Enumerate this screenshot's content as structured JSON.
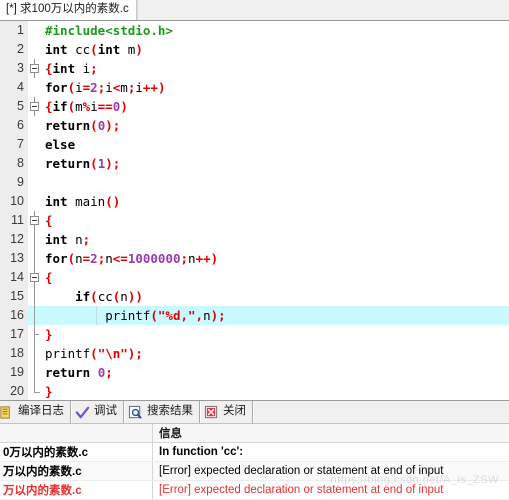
{
  "editor": {
    "tab_title": "[*] 求100万以内的素数.c",
    "current_line": 16,
    "highlight_color": "#c9faff",
    "gutter_color": "#ededed",
    "lines": [
      {
        "n": "1",
        "fold": "none",
        "tokens": [
          {
            "t": "#include<stdio.h>",
            "c": "pp"
          }
        ]
      },
      {
        "n": "2",
        "fold": "none",
        "tokens": [
          {
            "t": "int",
            "c": "k"
          },
          {
            "t": " cc",
            "c": "id"
          },
          {
            "t": "(",
            "c": "op"
          },
          {
            "t": "int",
            "c": "k"
          },
          {
            "t": " m",
            "c": "id"
          },
          {
            "t": ")",
            "c": "op"
          }
        ]
      },
      {
        "n": "3",
        "fold": "box",
        "tokens": [
          {
            "t": "{",
            "c": "op"
          },
          {
            "t": "int",
            "c": "k"
          },
          {
            "t": " i",
            "c": "id"
          },
          {
            "t": ";",
            "c": "op"
          }
        ]
      },
      {
        "n": "4",
        "fold": "none",
        "tokens": [
          {
            "t": "for",
            "c": "k"
          },
          {
            "t": "(",
            "c": "op"
          },
          {
            "t": "i",
            "c": "id"
          },
          {
            "t": "=",
            "c": "op"
          },
          {
            "t": "2",
            "c": "num"
          },
          {
            "t": ";",
            "c": "op"
          },
          {
            "t": "i",
            "c": "id"
          },
          {
            "t": "<",
            "c": "op"
          },
          {
            "t": "m",
            "c": "id"
          },
          {
            "t": ";",
            "c": "op"
          },
          {
            "t": "i",
            "c": "id"
          },
          {
            "t": "++",
            "c": "op"
          },
          {
            "t": ")",
            "c": "op"
          }
        ]
      },
      {
        "n": "5",
        "fold": "box",
        "tokens": [
          {
            "t": "{",
            "c": "op"
          },
          {
            "t": "if",
            "c": "k"
          },
          {
            "t": "(",
            "c": "op"
          },
          {
            "t": "m",
            "c": "id"
          },
          {
            "t": "%",
            "c": "op"
          },
          {
            "t": "i",
            "c": "id"
          },
          {
            "t": "==",
            "c": "op"
          },
          {
            "t": "0",
            "c": "num"
          },
          {
            "t": ")",
            "c": "op"
          }
        ]
      },
      {
        "n": "6",
        "fold": "none",
        "tokens": [
          {
            "t": "return",
            "c": "k"
          },
          {
            "t": "(",
            "c": "op"
          },
          {
            "t": "0",
            "c": "num"
          },
          {
            "t": ")",
            "c": "op"
          },
          {
            "t": ";",
            "c": "op"
          }
        ]
      },
      {
        "n": "7",
        "fold": "none",
        "tokens": [
          {
            "t": "else",
            "c": "k"
          }
        ]
      },
      {
        "n": "8",
        "fold": "none",
        "tokens": [
          {
            "t": "return",
            "c": "k"
          },
          {
            "t": "(",
            "c": "op"
          },
          {
            "t": "1",
            "c": "num"
          },
          {
            "t": ")",
            "c": "op"
          },
          {
            "t": ";",
            "c": "op"
          }
        ]
      },
      {
        "n": "9",
        "fold": "none",
        "tokens": []
      },
      {
        "n": "10",
        "fold": "none",
        "tokens": [
          {
            "t": "int",
            "c": "k"
          },
          {
            "t": " main",
            "c": "id"
          },
          {
            "t": "()",
            "c": "op"
          }
        ]
      },
      {
        "n": "11",
        "fold": "box-open",
        "tokens": [
          {
            "t": "{",
            "c": "op"
          }
        ]
      },
      {
        "n": "12",
        "fold": "line",
        "tokens": [
          {
            "t": "int",
            "c": "k"
          },
          {
            "t": " n",
            "c": "id"
          },
          {
            "t": ";",
            "c": "op"
          }
        ]
      },
      {
        "n": "13",
        "fold": "line",
        "tokens": [
          {
            "t": "for",
            "c": "k"
          },
          {
            "t": "(",
            "c": "op"
          },
          {
            "t": "n",
            "c": "id"
          },
          {
            "t": "=",
            "c": "op"
          },
          {
            "t": "2",
            "c": "num"
          },
          {
            "t": ";",
            "c": "op"
          },
          {
            "t": "n",
            "c": "id"
          },
          {
            "t": "<=",
            "c": "op"
          },
          {
            "t": "1000000",
            "c": "num"
          },
          {
            "t": ";",
            "c": "op"
          },
          {
            "t": "n",
            "c": "id"
          },
          {
            "t": "++",
            "c": "op"
          },
          {
            "t": ")",
            "c": "op"
          }
        ]
      },
      {
        "n": "14",
        "fold": "box-open",
        "tokens": [
          {
            "t": "{",
            "c": "op"
          }
        ]
      },
      {
        "n": "15",
        "fold": "line",
        "tokens": [
          {
            "t": "    if",
            "c": "k"
          },
          {
            "t": "(",
            "c": "op"
          },
          {
            "t": "cc",
            "c": "id"
          },
          {
            "t": "(",
            "c": "op"
          },
          {
            "t": "n",
            "c": "id"
          },
          {
            "t": "))",
            "c": "op"
          }
        ]
      },
      {
        "n": "16",
        "fold": "line",
        "cur": true,
        "tokens": [
          {
            "t": "        printf",
            "c": "id"
          },
          {
            "t": "(",
            "c": "op"
          },
          {
            "t": "\"%d,\"",
            "c": "str"
          },
          {
            "t": ",",
            "c": "op"
          },
          {
            "t": "n",
            "c": "id"
          },
          {
            "t": ")",
            "c": "op"
          },
          {
            "t": ";",
            "c": "op"
          }
        ]
      },
      {
        "n": "17",
        "fold": "mid",
        "tokens": [
          {
            "t": "}",
            "c": "op"
          }
        ]
      },
      {
        "n": "18",
        "fold": "line",
        "tokens": [
          {
            "t": "printf",
            "c": "id"
          },
          {
            "t": "(",
            "c": "op"
          },
          {
            "t": "\"\\n\"",
            "c": "str"
          },
          {
            "t": ")",
            "c": "op"
          },
          {
            "t": ";",
            "c": "op"
          }
        ]
      },
      {
        "n": "19",
        "fold": "line",
        "tokens": [
          {
            "t": "return",
            "c": "k"
          },
          {
            "t": " ",
            "c": "id"
          },
          {
            "t": "0",
            "c": "num"
          },
          {
            "t": ";",
            "c": "op"
          }
        ]
      },
      {
        "n": "20",
        "fold": "end",
        "tokens": [
          {
            "t": "}",
            "c": "op"
          }
        ]
      }
    ]
  },
  "panel": {
    "tabs": [
      {
        "label": "编译日志",
        "icon": "compile-log-icon"
      },
      {
        "label": "调试",
        "icon": "debug-check-icon"
      },
      {
        "label": "搜索结果",
        "icon": "search-results-icon"
      },
      {
        "label": "关闭",
        "icon": "close-icon"
      }
    ],
    "grid": {
      "headers": {
        "file": "",
        "info": "信息"
      },
      "rows": [
        {
          "file": "0万以内的素数.c",
          "info": "In function 'cc':",
          "style": "bold"
        },
        {
          "file": "万以内的素数.c",
          "info": "[Error] expected declaration or statement at end of input",
          "style": "normal"
        },
        {
          "file": "万以内的素数.c",
          "info": "[Error] expected declaration or statement at end of input",
          "style": "error"
        }
      ]
    },
    "watermark": "https://blog.csdn.net/A_is_ZSW"
  }
}
